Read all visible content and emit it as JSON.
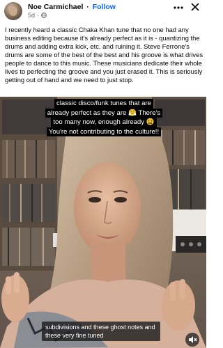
{
  "post": {
    "author_name": "Noe Carmichael",
    "separator": "·",
    "follow_label": "Follow",
    "timestamp": "5d",
    "meta_separator": "·",
    "privacy_icon": "globe-icon",
    "body": "I recently heard a classic Chaka Khan tune that no one had any business editing because it's already perfect as it is - quantizing the drums and adding extra kick, etc. and ruining it. Steve Ferrone's drums are some of the best of the best and his groove is what drives people to dance to this music. These musicians dedicate their whole lives to perfecting the groove and you just erased it. This is seriously getting out of hand and we need to just stop."
  },
  "video": {
    "overlay_lines": [
      "classic disco/funk tunes that are",
      "already perfect as they are 😤 There's",
      "too many now, enough already 😫",
      "You're not contributing to the culture!!"
    ],
    "subtitle": "subdivisions and these ghost notes and these very fine tuned"
  },
  "icons": {
    "more": "more-horizontal-icon",
    "close": "close-icon",
    "mute": "speaker-muted-icon"
  },
  "colors": {
    "follow": "#0866ff",
    "meta": "#65676b",
    "text": "#050505"
  }
}
